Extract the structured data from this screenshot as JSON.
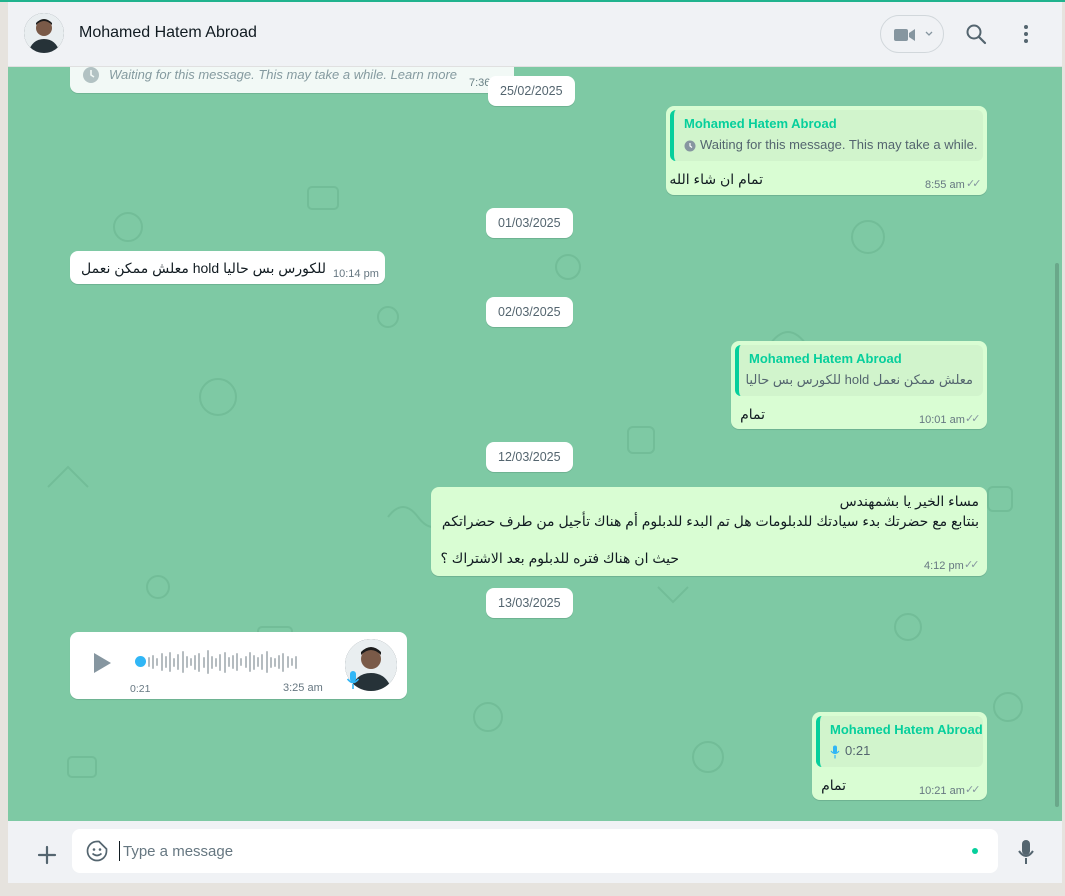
{
  "header": {
    "contact_name": "Mohamed Hatem Abroad",
    "video_icon": "video-call-icon",
    "search_icon": "search-icon",
    "menu_icon": "menu-dots-icon"
  },
  "chat": {
    "top_partial": {
      "text": "Waiting for this message. This may take a while. Learn more",
      "time": "7:36"
    },
    "dates": [
      "25/02/2025",
      "01/03/2025",
      "02/03/2025",
      "12/03/2025",
      "13/03/2025"
    ],
    "msg1": {
      "quote_name": "Mohamed Hatem Abroad",
      "quote_body": "Waiting for this message. This may take a while.",
      "text": "تمام ان شاء الله",
      "time": "8:55 am"
    },
    "msg2": {
      "text": "معلش ممكن نعمل hold للكورس بس حاليا",
      "time": "10:14 pm"
    },
    "msg3": {
      "quote_name": "Mohamed Hatem Abroad",
      "quote_body": "معلش ممكن نعمل hold للكورس بس حاليا",
      "text": "تمام",
      "time": "10:01 am"
    },
    "msg4": {
      "line1": "مساء الخير يا بشمهندس",
      "line2": "بنتابع مع حضرتك بدء سيادتك للدبلومات هل تم البدء للدبلوم أم هناك تأجيل من طرف حضراتكم",
      "line3": "حيث ان هناك فتره للدبلوم بعد الاشتراك ؟",
      "time": "4:12 pm"
    },
    "voice": {
      "duration": "0:21",
      "time": "3:25 am",
      "play_icon": "play-icon",
      "mic_icon": "mic-icon"
    },
    "msg5": {
      "quote_name": "Mohamed Hatem Abroad",
      "quote_duration": "0:21",
      "text": "تمام",
      "time": "10:21 am"
    }
  },
  "footer": {
    "placeholder": "Type a message",
    "attach_icon": "plus-icon",
    "sticker_icon": "sticker-icon",
    "mic_icon": "mic-icon"
  },
  "colors": {
    "chat_bg": "#7ec9a4",
    "incoming": "#ffffff",
    "outgoing": "#d9fdd3",
    "accent": "#06cf9c"
  }
}
